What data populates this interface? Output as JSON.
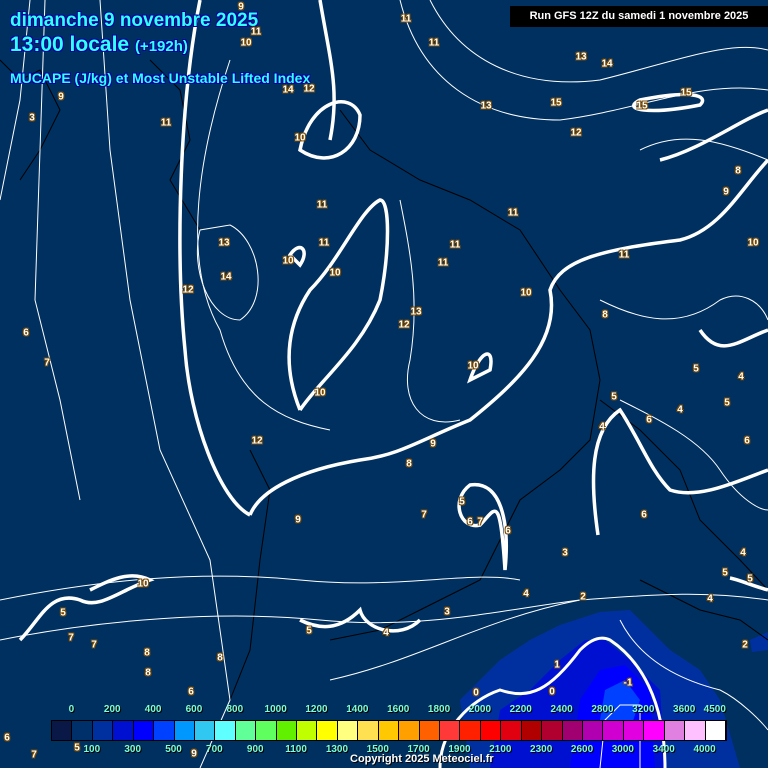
{
  "header": {
    "date": "dimanche 9 novembre 2025",
    "time": "13:00 locale",
    "lead": "(+192h)",
    "field": "MUCAPE (J/kg) et Most Unstable Lifted Index",
    "run": "Run GFS 12Z du samedi 1 novembre 2025"
  },
  "colorbar": {
    "top_labels": [
      "0",
      "200",
      "400",
      "600",
      "800",
      "1000",
      "1200",
      "1400",
      "1600",
      "1800",
      "2000",
      "2200",
      "2400",
      "2800",
      "3200",
      "3600",
      "4500"
    ],
    "bottom_labels": [
      "100",
      "300",
      "500",
      "700",
      "900",
      "1100",
      "1300",
      "1500",
      "1700",
      "1900",
      "2100",
      "2300",
      "2600",
      "3000",
      "3400",
      "4000"
    ],
    "colors": [
      "#0a1848",
      "#00306a",
      "#0030a0",
      "#0010d0",
      "#0000ff",
      "#0040ff",
      "#0098ff",
      "#30c8f0",
      "#60ffff",
      "#60ff98",
      "#60ff60",
      "#60f000",
      "#c0ff00",
      "#ffff00",
      "#ffff80",
      "#ffe050",
      "#ffc800",
      "#ffa000",
      "#ff6000",
      "#ff3838",
      "#ff2000",
      "#ff0000",
      "#e00010",
      "#b00000",
      "#b00030",
      "#a00070",
      "#b000b0",
      "#d000d0",
      "#e000e0",
      "#ff00ff",
      "#e080e0",
      "#ffc0ff",
      "#ffffff"
    ]
  },
  "lifted_index_labels": [
    "9",
    "11",
    "10",
    "11",
    "11",
    "13",
    "14",
    "13",
    "15",
    "15",
    "15",
    "12",
    "9",
    "3",
    "11",
    "14",
    "12",
    "10",
    "11",
    "11",
    "13",
    "14",
    "12",
    "10",
    "10",
    "11",
    "11",
    "11",
    "11",
    "10",
    "9",
    "8",
    "10",
    "8",
    "13",
    "12",
    "6",
    "7",
    "10",
    "5",
    "4",
    "5",
    "5",
    "4",
    "6",
    "4",
    "6",
    "10",
    "12",
    "9",
    "8",
    "9",
    "5",
    "6",
    "7",
    "7",
    "6",
    "6",
    "3",
    "4",
    "5",
    "5",
    "10",
    "5",
    "7",
    "7",
    "5",
    "4",
    "3",
    "4",
    "2",
    "4",
    "2",
    "8",
    "8",
    "8",
    "6",
    "1",
    "0",
    "0",
    "-1",
    "6",
    "7",
    "9",
    "5"
  ],
  "copyright": "Copyright 2025 Meteociel.fr"
}
